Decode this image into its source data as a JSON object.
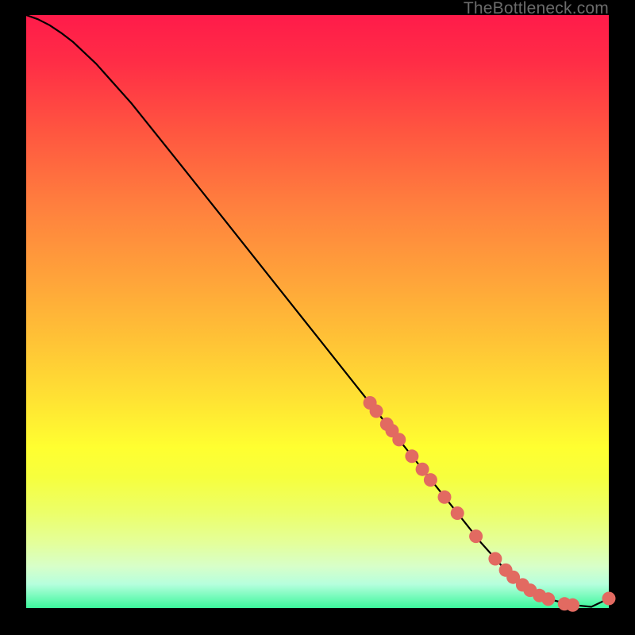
{
  "watermark": "TheBottleneck.com",
  "chart_data": {
    "type": "line",
    "title": "",
    "xlabel": "",
    "ylabel": "",
    "xlim": [
      0,
      100
    ],
    "ylim": [
      0,
      100
    ],
    "grid": false,
    "legend": false,
    "series": [
      {
        "name": "bottleneck-curve",
        "color": "#000000",
        "x": [
          0,
          2,
          4,
          6,
          8,
          12,
          18,
          26,
          34,
          42,
          50,
          58,
          66,
          72,
          78,
          82,
          86,
          90,
          94,
          97,
          100
        ],
        "y": [
          100,
          99.3,
          98.3,
          97.0,
          95.5,
          91.8,
          85.2,
          75.4,
          65.5,
          55.6,
          45.7,
          35.8,
          25.9,
          18.5,
          11.1,
          6.7,
          3.3,
          1.4,
          0.5,
          0.2,
          1.6
        ]
      },
      {
        "name": "highlight-dots",
        "color": "#e26a61",
        "type_hint": "scatter",
        "x": [
          59.0,
          60.1,
          61.9,
          62.8,
          64.0,
          66.2,
          68.0,
          69.4,
          71.8,
          74.0,
          77.2,
          80.5,
          82.3,
          83.6,
          85.2,
          86.5,
          88.1,
          89.6,
          92.4,
          93.8,
          100.0
        ],
        "y": [
          34.6,
          33.2,
          31.0,
          29.9,
          28.4,
          25.6,
          23.4,
          21.6,
          18.7,
          16.0,
          12.1,
          8.3,
          6.4,
          5.2,
          3.9,
          3.0,
          2.1,
          1.5,
          0.7,
          0.5,
          1.6
        ]
      }
    ]
  },
  "palette": {
    "dot_fill": "#e26a61",
    "dot_stroke": "#c94f49",
    "curve": "#000000"
  }
}
